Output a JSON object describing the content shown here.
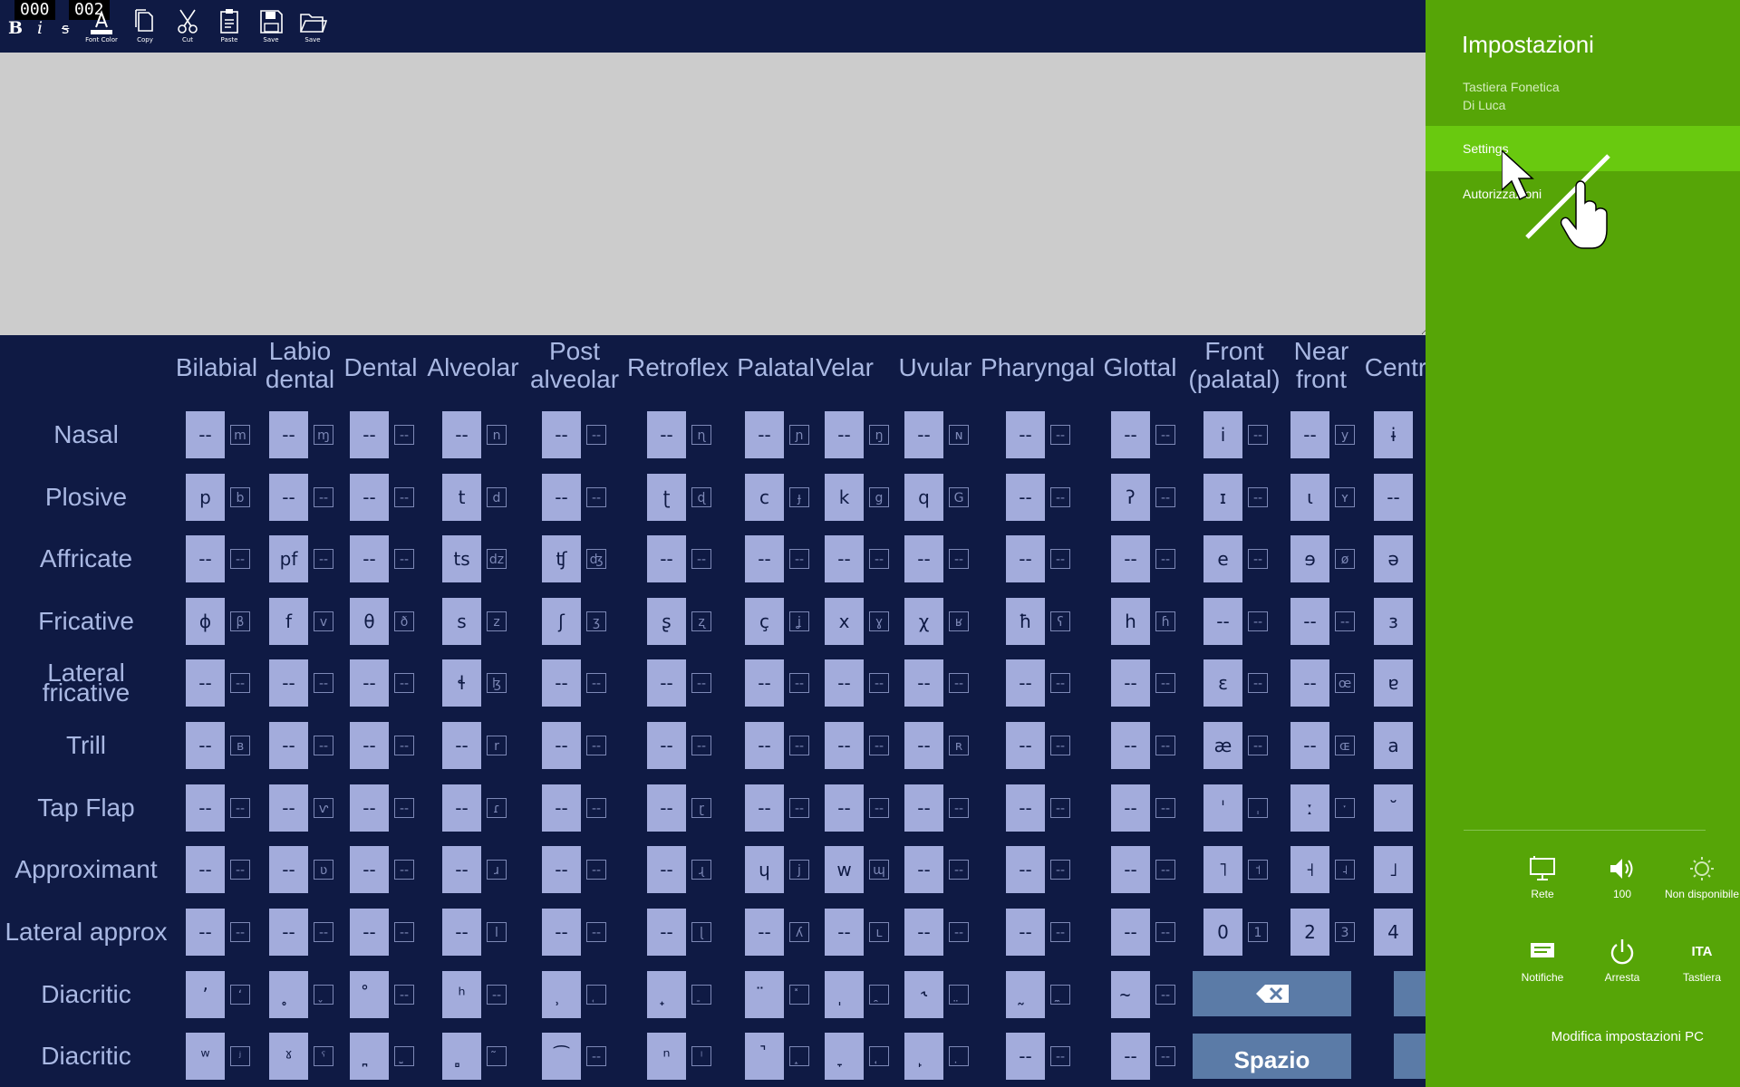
{
  "toolbar": {
    "counters": [
      "000",
      "002"
    ],
    "format": {
      "bold": "B",
      "italic": "i",
      "strike": "s"
    },
    "tools": [
      {
        "name": "font-color-button",
        "icon": "font-color-icon",
        "label": "Font Color"
      },
      {
        "name": "copy-button",
        "icon": "copy-icon",
        "label": "Copy"
      },
      {
        "name": "cut-button",
        "icon": "scissors-icon",
        "label": "Cut"
      },
      {
        "name": "paste-button",
        "icon": "paste-icon",
        "label": "Paste"
      },
      {
        "name": "save-button",
        "icon": "floppy-icon",
        "label": "Save"
      },
      {
        "name": "open-button",
        "icon": "folder-icon",
        "label": "Save"
      }
    ]
  },
  "editor": {
    "value": ""
  },
  "keyboard": {
    "columns": [
      "Bilabial",
      "Labio\ndental",
      "Dental",
      "Alveolar",
      "Post\nalveolar",
      "Retroflex",
      "Palatal",
      "Velar",
      "Uvular",
      "Pharyngal",
      "Glottal",
      "Front\n(palatal)",
      "Near\nfront",
      "Centr"
    ],
    "rows": [
      {
        "label": "Nasal",
        "keys": [
          [
            "--",
            "m"
          ],
          [
            "--",
            "ɱ"
          ],
          [
            "--",
            "--"
          ],
          [
            "--",
            "n"
          ],
          [
            "--",
            "--"
          ],
          [
            "--",
            "ɳ"
          ],
          [
            "--",
            "ɲ"
          ],
          [
            "--",
            "ŋ"
          ],
          [
            "--",
            "ɴ"
          ],
          [
            "--",
            "--"
          ],
          [
            "--",
            "--"
          ],
          [
            "i",
            "--"
          ],
          [
            "--",
            "y"
          ],
          [
            "ɨ",
            ""
          ]
        ]
      },
      {
        "label": "Plosive",
        "keys": [
          [
            "p",
            "b"
          ],
          [
            "--",
            "--"
          ],
          [
            "--",
            "--"
          ],
          [
            "t",
            "d"
          ],
          [
            "--",
            "--"
          ],
          [
            "ʈ",
            "ɖ"
          ],
          [
            "c",
            "ɟ"
          ],
          [
            "k",
            "g"
          ],
          [
            "q",
            "G"
          ],
          [
            "--",
            "--"
          ],
          [
            "ʔ",
            "--"
          ],
          [
            "ɪ",
            "--"
          ],
          [
            "ɩ",
            "ʏ"
          ],
          [
            "--",
            ""
          ]
        ]
      },
      {
        "label": "Affricate",
        "keys": [
          [
            "--",
            "--"
          ],
          [
            "pf",
            "--"
          ],
          [
            "--",
            "--"
          ],
          [
            "ts",
            "dz"
          ],
          [
            "ʧ",
            "ʤ"
          ],
          [
            "--",
            "--"
          ],
          [
            "--",
            "--"
          ],
          [
            "--",
            "--"
          ],
          [
            "--",
            "--"
          ],
          [
            "--",
            "--"
          ],
          [
            "--",
            "--"
          ],
          [
            "e",
            "--"
          ],
          [
            "ɘ",
            "ø"
          ],
          [
            "ə",
            ""
          ]
        ]
      },
      {
        "label": "Fricative",
        "keys": [
          [
            "ɸ",
            "β"
          ],
          [
            "f",
            "v"
          ],
          [
            "θ",
            "ð"
          ],
          [
            "s",
            "z"
          ],
          [
            "ʃ",
            "ʒ"
          ],
          [
            "ʂ",
            "ʐ"
          ],
          [
            "ç",
            "ʝ"
          ],
          [
            "x",
            "ɣ"
          ],
          [
            "χ",
            "ʁ"
          ],
          [
            "ħ",
            "ʕ"
          ],
          [
            "h",
            "ɦ"
          ],
          [
            "--",
            "--"
          ],
          [
            "--",
            "--"
          ],
          [
            "ɜ",
            ""
          ]
        ]
      },
      {
        "label": "Lateral\nfricative",
        "keys": [
          [
            "--",
            "--"
          ],
          [
            "--",
            "--"
          ],
          [
            "--",
            "--"
          ],
          [
            "ɬ",
            "ɮ"
          ],
          [
            "--",
            "--"
          ],
          [
            "--",
            "--"
          ],
          [
            "--",
            "--"
          ],
          [
            "--",
            "--"
          ],
          [
            "--",
            "--"
          ],
          [
            "--",
            "--"
          ],
          [
            "--",
            "--"
          ],
          [
            "ɛ",
            "--"
          ],
          [
            "--",
            "œ"
          ],
          [
            "ɐ",
            ""
          ]
        ]
      },
      {
        "label": "Trill",
        "keys": [
          [
            "--",
            "ʙ"
          ],
          [
            "--",
            "--"
          ],
          [
            "--",
            "--"
          ],
          [
            "--",
            "r"
          ],
          [
            "--",
            "--"
          ],
          [
            "--",
            "--"
          ],
          [
            "--",
            "--"
          ],
          [
            "--",
            "--"
          ],
          [
            "--",
            "ʀ"
          ],
          [
            "--",
            "--"
          ],
          [
            "--",
            "--"
          ],
          [
            "æ",
            "--"
          ],
          [
            "--",
            "ɶ"
          ],
          [
            "a",
            ""
          ]
        ]
      },
      {
        "label": "Tap Flap",
        "keys": [
          [
            "--",
            "--"
          ],
          [
            "--",
            "ⱱ"
          ],
          [
            "--",
            "--"
          ],
          [
            "--",
            "ɾ"
          ],
          [
            "--",
            "--"
          ],
          [
            "--",
            "ɽ"
          ],
          [
            "--",
            "--"
          ],
          [
            "--",
            "--"
          ],
          [
            "--",
            "--"
          ],
          [
            "--",
            "--"
          ],
          [
            "--",
            "--"
          ],
          [
            "ˈ",
            "ˌ"
          ],
          [
            "ː",
            "ˑ"
          ],
          [
            "˘",
            ""
          ]
        ]
      },
      {
        "label": "Approximant",
        "keys": [
          [
            "--",
            "--"
          ],
          [
            "--",
            "ʋ"
          ],
          [
            "--",
            "--"
          ],
          [
            "--",
            "ɹ"
          ],
          [
            "--",
            "--"
          ],
          [
            "--",
            "ɻ"
          ],
          [
            "ɥ",
            "j"
          ],
          [
            "w",
            "ɰ"
          ],
          [
            "--",
            "--"
          ],
          [
            "--",
            "--"
          ],
          [
            "--",
            "--"
          ],
          [
            "˥",
            "˦"
          ],
          [
            "˧",
            "˨"
          ],
          [
            "˩",
            ""
          ]
        ]
      },
      {
        "label": "Lateral approx",
        "keys": [
          [
            "--",
            "--"
          ],
          [
            "--",
            "--"
          ],
          [
            "--",
            "--"
          ],
          [
            "--",
            "l"
          ],
          [
            "--",
            "--"
          ],
          [
            "--",
            "ɭ"
          ],
          [
            "--",
            "ʎ"
          ],
          [
            "--",
            "ʟ"
          ],
          [
            "--",
            "--"
          ],
          [
            "--",
            "--"
          ],
          [
            "--",
            "--"
          ],
          [
            "0",
            "1"
          ],
          [
            "2",
            "3"
          ],
          [
            "4",
            ""
          ]
        ]
      },
      {
        "label": "Diacritic",
        "keys": [
          [
            "ʼ",
            "ʻ"
          ],
          [
            "̥",
            "̬"
          ],
          [
            "̊",
            "--"
          ],
          [
            "ʰ",
            "--"
          ],
          [
            "̹",
            "̜"
          ],
          [
            "̟",
            "̠"
          ],
          [
            "̈",
            "̽"
          ],
          [
            "̩",
            "̯"
          ],
          [
            "˞",
            "̤"
          ],
          [
            "̰",
            "̼"
          ],
          [
            "̴",
            "--"
          ]
        ]
      },
      {
        "label": "Diacritic",
        "keys": [
          [
            "ʷ",
            "ʲ"
          ],
          [
            "ˠ",
            "ˤ"
          ],
          [
            "̪",
            "̺"
          ],
          [
            "̻",
            "̃"
          ],
          [
            "͡",
            "--"
          ],
          [
            "ⁿ",
            "ˡ"
          ],
          [
            "̚",
            "̝"
          ],
          [
            "̞",
            "̘"
          ],
          [
            "̙",
            "̣"
          ],
          [
            "--",
            "--"
          ],
          [
            "--",
            "--"
          ]
        ]
      }
    ],
    "backspace_icon": "backspace-icon",
    "space_label": "Spazio"
  },
  "settings": {
    "title": "Impostazioni",
    "app_name": "Tastiera Fonetica",
    "app_author": "Di Luca",
    "items": [
      "Settings",
      "Autorizzazioni"
    ],
    "quick": [
      {
        "icon": "network-icon",
        "label": "Rete"
      },
      {
        "icon": "volume-icon",
        "label": "100"
      },
      {
        "icon": "brightness-icon",
        "label": "Non disponibile"
      },
      {
        "icon": "notifications-icon",
        "label": "Notifiche"
      },
      {
        "icon": "power-icon",
        "label": "Arresta"
      },
      {
        "icon": "keyboard-icon",
        "label": "Tastiera",
        "text": "ITA"
      }
    ],
    "footer": "Modifica impostazioni PC"
  }
}
